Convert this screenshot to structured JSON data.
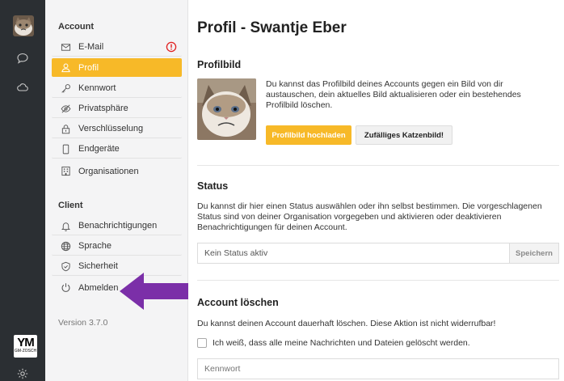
{
  "rail": {
    "icons": [
      "user-avatar",
      "chat-bubble-icon",
      "cloud-icon",
      "settings-gear-icon"
    ],
    "logo": {
      "text": "YM",
      "subtext": "GM·ZOSCH"
    }
  },
  "menu": {
    "account_heading": "Account",
    "account_items": [
      {
        "label": "E-Mail",
        "icon": "mail-icon",
        "alert": true
      },
      {
        "label": "Profil",
        "icon": "user-icon",
        "active": true
      },
      {
        "label": "Kennwort",
        "icon": "key-icon"
      },
      {
        "label": "Privatsphäre",
        "icon": "eye-slash-icon"
      },
      {
        "label": "Verschlüsselung",
        "icon": "lock-icon"
      },
      {
        "label": "Endgeräte",
        "icon": "device-icon"
      },
      {
        "label": "Organisationen",
        "icon": "building-icon"
      }
    ],
    "client_heading": "Client",
    "client_items": [
      {
        "label": "Benachrichtigungen",
        "icon": "bell-icon"
      },
      {
        "label": "Sprache",
        "icon": "globe-icon"
      },
      {
        "label": "Sicherheit",
        "icon": "shield-icon"
      },
      {
        "label": "Abmelden",
        "icon": "power-icon"
      }
    ],
    "version": "Version 3.7.0"
  },
  "main": {
    "title": "Profil - Swantje Eber",
    "profile_picture": {
      "heading": "Profilbild",
      "description": "Du kannst das Profilbild deines Accounts gegen ein Bild von dir austauschen, dein aktuelles Bild aktualisieren oder ein bestehendes Profilbild löschen.",
      "upload_label": "Profilbild hochladen",
      "random_label": "Zufälliges Katzenbild!"
    },
    "status": {
      "heading": "Status",
      "description": "Du kannst dir hier einen Status auswählen oder ihn selbst bestimmen. Die vorgeschlagenen Status sind von deiner Organisation vorgegeben und aktivieren oder deaktivieren Benachrichtigungen für deinen Account.",
      "input_value": "Kein Status aktiv",
      "save_label": "Speichern"
    },
    "delete_account": {
      "heading": "Account löschen",
      "description": "Du kannst deinen Account dauerhaft löschen. Diese Aktion ist nicht widerrufbar!",
      "checkbox_label": "Ich weiß, dass alle meine Nachrichten und Dateien gelöscht werden.",
      "password_placeholder": "Kennwort"
    }
  },
  "colors": {
    "accent": "#f7b928",
    "rail": "#2b2f33",
    "menu_bg": "#f4f4f5",
    "alert": "#e02020",
    "arrow": "#7b2fa8"
  }
}
